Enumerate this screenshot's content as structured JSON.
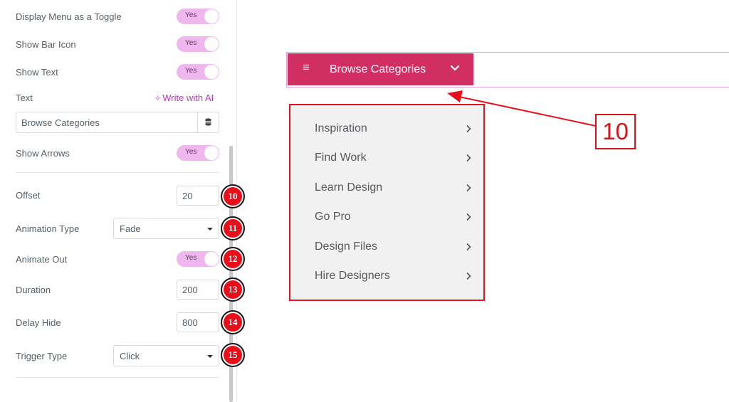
{
  "settings": {
    "display_menu_toggle": {
      "label": "Display Menu as a Toggle",
      "value": "Yes"
    },
    "show_bar_icon": {
      "label": "Show Bar Icon",
      "value": "Yes"
    },
    "show_text": {
      "label": "Show Text",
      "value": "Yes"
    },
    "text": {
      "label": "Text",
      "ai_link": "Write with AI",
      "value": "Browse Categories"
    },
    "show_arrows": {
      "label": "Show Arrows",
      "value": "Yes"
    },
    "offset": {
      "label": "Offset",
      "value": "20",
      "badge": "10"
    },
    "animation_type": {
      "label": "Animation Type",
      "value": "Fade",
      "badge": "11"
    },
    "animate_out": {
      "label": "Animate Out",
      "value": "Yes",
      "badge": "12"
    },
    "duration": {
      "label": "Duration",
      "value": "200",
      "badge": "13"
    },
    "delay_hide": {
      "label": "Delay Hide",
      "value": "800",
      "badge": "14"
    },
    "trigger_type": {
      "label": "Trigger Type",
      "value": "Click",
      "badge": "15"
    }
  },
  "preview": {
    "button_label": "Browse Categories",
    "menu_items": [
      "Inspiration",
      "Find Work",
      "Learn Design",
      "Go Pro",
      "Design Files",
      "Hire Designers"
    ],
    "callout_number": "10"
  },
  "icons": {
    "bar": "hamburger-icon",
    "chevron": "chevron-down-icon",
    "arrow": "chevron-right-icon",
    "database": "database-icon",
    "sparkle": "sparkle-icon"
  },
  "colors": {
    "toggle": "#f0b7ee",
    "accent_pink": "#c036c3",
    "button": "#d12e64",
    "annotation_red": "#e3141d",
    "badge": "#e80f1a"
  }
}
